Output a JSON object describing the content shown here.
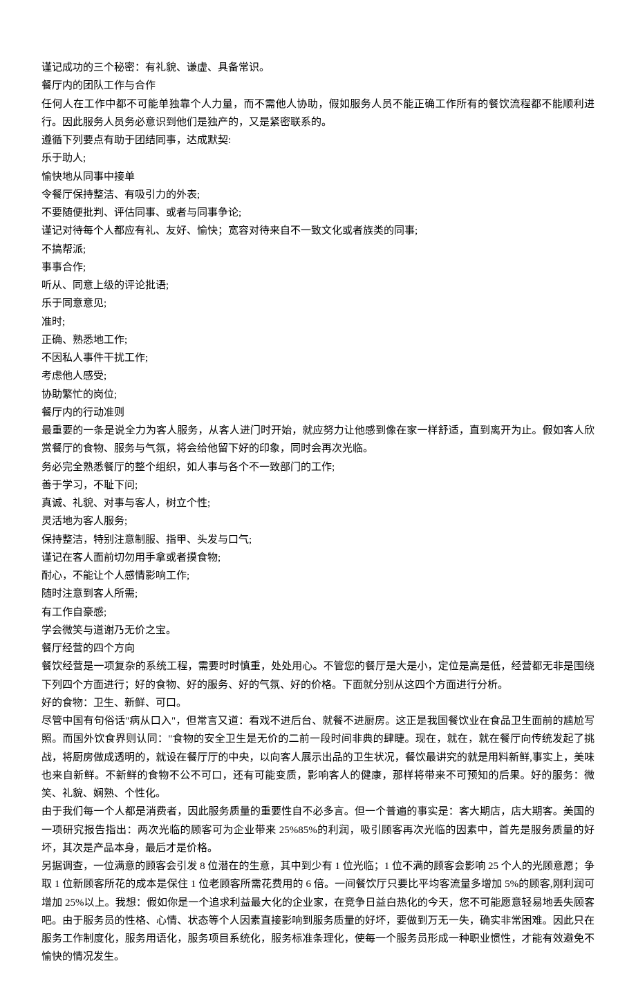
{
  "paragraphs": [
    "谨记成功的三个秘密：有礼貌、谦虚、具备常识。",
    "餐厅内的团队工作与合作",
    "任何人在工作中都不可能单独靠个人力量，而不需他人协助，假如服务人员不能正确工作所有的餐饮流程都不能顺利进行。因此服务人员务必意识到他们是独产的，又是紧密联系的。",
    "遵循下列要点有助于团结同事，达成默契:",
    "乐于助人;",
    "愉快地从同事中接单",
    "令餐厅保持整洁、有吸引力的外表;",
    "不要随便批判、评估同事、或者与同事争论;",
    "谨记对待每个人都应有礼、友好、愉快；宽容对待来自不一致文化或者族类的同事;",
    "不搞帮派;",
    "事事合作;",
    "听从、同意上级的评论批语;",
    "乐于同意意见;",
    "准时;",
    "正确、熟悉地工作;",
    "不因私人事件干扰工作;",
    "考虑他人感受;",
    "协助繁忙的岗位;",
    "餐厅内的行动准则",
    "最重要的一条是说全力为客人服务，从客人进门时开始，就应努力让他感到像在家一样舒适，直到离开为止。假如客人欣赏餐厅的食物、服务与气氛，将会给他留下好的印象，同时会再次光临。",
    "务必完全熟悉餐厅的整个组织，如人事与各个不一致部门的工作;",
    "善于学习，不耻下问;",
    "真诚、礼貌、对事与客人，树立个性;",
    "灵活地为客人服务;",
    "保持整洁，特别注意制服、指甲、头发与口气;",
    "谨记在客人面前切勿用手拿或者摸食物;",
    "耐心，不能让个人感情影响工作;",
    "随时注意到客人所需;",
    "有工作自豪感;",
    "学会微笑与道谢乃无价之宝。",
    "餐厅经营的四个方向",
    "餐饮经营是一项复杂的系统工程，需要时时慎重，处处用心。不管您的餐厅是大是小，定位是高是低，经营都无非是围绕下列四个方面进行；好的食物、好的服务、好的气氛、好的价格。下面就分别从这四个方面进行分析。",
    "好的食物：卫生、新鲜、可口。",
    "尽管中国有句俗话\"病从口入\"，但常言又道：看戏不进后台、就餐不进厨房。这正是我国餐饮业在食品卫生面前的尴尬写照。而国外饮食界则认同：\"食物的安全卫生是无价的二前一段时间非典的肆睫。现在，就在，就在餐厅向传统发起了挑战，将厨房做成透明的，就设在餐厅厅的中央，以向客人展示出品的卫生状况，餐饮最讲究的就是用料新鲜,事实上，美味也来自新鲜。不新鲜的食物不公不可口，还有可能变质，影响客人的健康，那样将带来不可预知的后果。好的服务：微笑、礼貌、娴熟、个性化。",
    "由于我们每一个人都是消费者，因此服务质量的重要性自不必多言。但一个普遍的事实是：客大期店，店大期客。美国的一项研究报告指出：两次光临的顾客可为企业带来 25%85%的利润，吸引顾客再次光临的因素中，首先是服务质量的好坏，其次是产品本身，最后才是价格。",
    "另据调查，一位满意的顾客会引发 8 位潜在的生意，其中到少有 1 位光临；1 位不满的顾客会影响 25 个人的光顾意愿；争取 1 位新顾客所花的成本是保住 1 位老顾客所需花费用的 6 倍。一间餐饮厅只要比平均客流量多增加 5%的顾客,刚利润可增加 25%以上。我想：假如你是一个追求利益最大化的企业家，在竞争日益白热化的今天，您不可能愿意轻易地丢失顾客吧。由于服务员的性格、心情、状态等个人因素直接影响到服务质量的好坏，要做到万无一失，确实非常困难。因此只在服务工作制度化，服务用语化，服务项目系统化，服务标准条理化，使每一个服务员形成一种职业惯性，才能有效避免不愉快的情况发生。"
  ]
}
